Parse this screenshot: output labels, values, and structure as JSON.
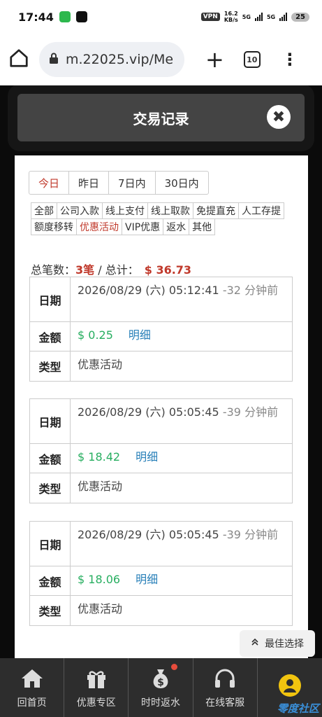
{
  "status_bar": {
    "time": "17:44",
    "vpn": "VPN",
    "speed_value": "16.2",
    "speed_unit": "KB/s",
    "sig1": "5G",
    "sig2": "5G",
    "battery": "25"
  },
  "browser": {
    "url": "m.22025.vip/Me",
    "tab_count": "10"
  },
  "modal": {
    "title": "交易记录",
    "close": "✖"
  },
  "date_filters": [
    {
      "label": "今日",
      "active": true
    },
    {
      "label": "昨日",
      "active": false
    },
    {
      "label": "7日内",
      "active": false
    },
    {
      "label": "30日内",
      "active": false
    }
  ],
  "categories": [
    {
      "label": "全部",
      "active": false
    },
    {
      "label": "公司入款",
      "active": false
    },
    {
      "label": "线上支付",
      "active": false
    },
    {
      "label": "线上取款",
      "active": false
    },
    {
      "label": "免提直充",
      "active": false
    },
    {
      "label": "人工存提",
      "active": false
    },
    {
      "label": "额度移转",
      "active": false
    },
    {
      "label": "优惠活动",
      "active": true
    },
    {
      "label": "VIP优惠",
      "active": false
    },
    {
      "label": "返水",
      "active": false
    },
    {
      "label": "其他",
      "active": false
    }
  ],
  "summary": {
    "count_label": "总笔数：",
    "count_value": "3笔",
    "separator": " / ",
    "total_label": "总计：",
    "total_value": "$ 36.73"
  },
  "labels": {
    "date": "日期",
    "amount": "金额",
    "type": "类型",
    "detail": "明细"
  },
  "records": [
    {
      "datetime": "2026/08/29 (六) 05:12:41",
      "ago": "-32 分钟前",
      "amount": "$ 0.25",
      "type": "优惠活动"
    },
    {
      "datetime": "2026/08/29 (六) 05:05:45",
      "ago": "-39 分钟前",
      "amount": "$ 18.42",
      "type": "优惠活动"
    },
    {
      "datetime": "2026/08/29 (六) 05:05:45",
      "ago": "-39 分钟前",
      "amount": "$ 18.06",
      "type": "优惠活动"
    }
  ],
  "best_choice": "最佳选择",
  "bottom_nav": [
    {
      "label": "回首页",
      "icon": "home-icon"
    },
    {
      "label": "优惠专区",
      "icon": "gift-icon"
    },
    {
      "label": "时时返水",
      "icon": "money-bag-icon"
    },
    {
      "label": "在线客服",
      "icon": "headset-icon"
    },
    {
      "label": "",
      "icon": "user-icon"
    }
  ],
  "watermark": "零度社区",
  "colors": {
    "accent_red": "#c0392b",
    "money_green": "#27ae60",
    "link_blue": "#2980b9",
    "nav_bg": "#2d2d2d"
  }
}
